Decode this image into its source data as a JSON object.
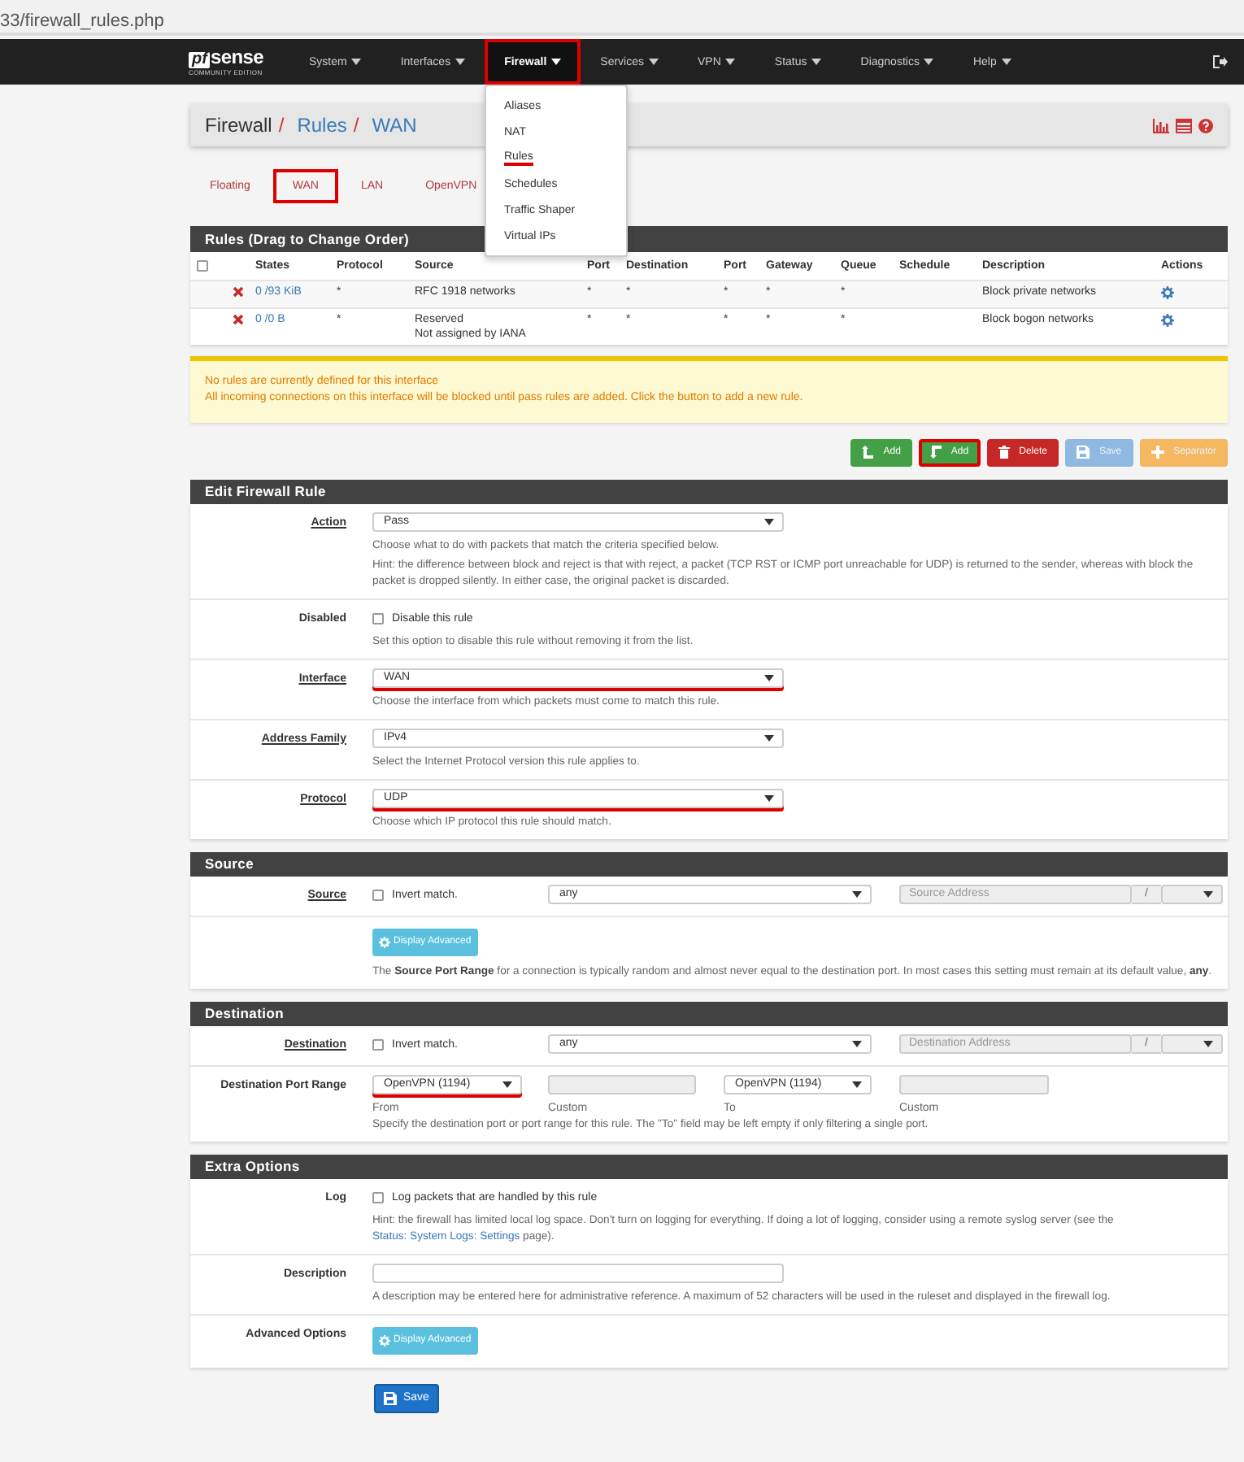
{
  "address_bar": {
    "url": "33/firewall_rules.php"
  },
  "navbar": {
    "logo_mark": "pf",
    "logo_text": "sense",
    "logo_subtitle": "COMMUNITY EDITION",
    "menu": [
      {
        "label": "System",
        "selected": false
      },
      {
        "label": "Interfaces",
        "selected": false
      },
      {
        "label": "Firewall",
        "selected": true
      },
      {
        "label": "Services",
        "selected": false
      },
      {
        "label": "VPN",
        "selected": false
      },
      {
        "label": "Status",
        "selected": false
      },
      {
        "label": "Diagnostics",
        "selected": false
      },
      {
        "label": "Help",
        "selected": false
      }
    ],
    "dropdown": [
      {
        "label": "Aliases",
        "selected": false
      },
      {
        "label": "NAT",
        "selected": false
      },
      {
        "label": "Rules",
        "selected": true
      },
      {
        "label": "Schedules",
        "selected": false
      },
      {
        "label": "Traffic Shaper",
        "selected": false
      },
      {
        "label": "Virtual IPs",
        "selected": false
      }
    ]
  },
  "breadcrumb": {
    "separator": "/",
    "items": [
      {
        "label": "Firewall",
        "link": false
      },
      {
        "label": "Rules",
        "link": true
      },
      {
        "label": "WAN",
        "link": true
      }
    ]
  },
  "tabs": [
    {
      "label": "Floating",
      "selected": false
    },
    {
      "label": "WAN",
      "selected": true
    },
    {
      "label": "LAN",
      "selected": false
    },
    {
      "label": "OpenVPN",
      "selected": false
    }
  ],
  "rules_table": {
    "title": "Rules (Drag to Change Order)",
    "select_all_checked": false,
    "columns": [
      "States",
      "Protocol",
      "Source",
      "Port",
      "Destination",
      "Port",
      "Gateway",
      "Queue",
      "Schedule",
      "Description",
      "Actions"
    ],
    "rows": [
      {
        "states": "0 /93 KiB",
        "protocol": "*",
        "source": [
          "RFC 1918 networks"
        ],
        "source_port": "*",
        "destination": "*",
        "destination_port": "*",
        "gateway": "*",
        "queue": "*",
        "description": "Block private networks"
      },
      {
        "states": "0 /0 B",
        "protocol": "*",
        "source": [
          "Reserved",
          "Not assigned by IANA"
        ],
        "source_port": "*",
        "destination": "*",
        "destination_port": "*",
        "gateway": "*",
        "queue": "*",
        "description": "Block bogon networks"
      }
    ]
  },
  "alert": {
    "lines": [
      "No rules are currently defined for this interface",
      "All incoming connections on this interface will be blocked until pass rules are added. Click the button to add a new rule."
    ]
  },
  "buttons": [
    {
      "kind": "add_top",
      "label": "Add",
      "color": "#43a047",
      "highlighted": false,
      "disabled": false
    },
    {
      "kind": "add_bottom",
      "label": "Add",
      "color": "#43a047",
      "highlighted": true,
      "disabled": false
    },
    {
      "kind": "delete",
      "label": "Delete",
      "color": "#c62828",
      "highlighted": false,
      "disabled": false
    },
    {
      "kind": "save",
      "label": "Save",
      "color": "#8fb9e0",
      "highlighted": false,
      "disabled": true
    },
    {
      "kind": "separator",
      "label": "Separator",
      "color": "#f5b760",
      "highlighted": false,
      "disabled": true
    }
  ],
  "sections": [
    {
      "title": "Edit Firewall Rule",
      "rows": [
        {
          "kind": "select",
          "label": "Action",
          "required": true,
          "value": "Pass",
          "marked": false,
          "help": [
            "Choose what to do with packets that match the criteria specified below.",
            "Hint: the difference between block and reject is that with reject, a packet (TCP RST or ICMP port unreachable for UDP) is returned to the sender, whereas with block the packet is dropped silently. In either case, the original packet is discarded."
          ]
        },
        {
          "kind": "checkbox",
          "label": "Disabled",
          "required": false,
          "checked": false,
          "text": "Disable this rule",
          "help": [
            "Set this option to disable this rule without removing it from the list."
          ]
        },
        {
          "kind": "select",
          "label": "Interface",
          "required": true,
          "value": "WAN",
          "marked": true,
          "help": [
            "Choose the interface from which packets must come to match this rule."
          ]
        },
        {
          "kind": "select",
          "label": "Address Family",
          "required": true,
          "value": "IPv4",
          "marked": false,
          "help": [
            "Select the Internet Protocol version this rule applies to."
          ]
        },
        {
          "kind": "select",
          "label": "Protocol",
          "required": true,
          "value": "UDP",
          "marked": true,
          "help": [
            "Choose which IP protocol this rule should match."
          ]
        }
      ]
    },
    {
      "title": "Source",
      "rows": [
        {
          "kind": "address",
          "label": "Source",
          "required": true,
          "invert_text": "Invert match.",
          "checked": false,
          "value": "any",
          "address_placeholder": "Source Address",
          "slash": "/"
        },
        {
          "kind": "advanced",
          "button": "Display Advanced",
          "help": [
            "The **Source Port Range** for a connection is typically random and almost never equal to the destination port. In most cases this setting must remain at its default value, **any**."
          ]
        }
      ]
    },
    {
      "title": "Destination",
      "rows": [
        {
          "kind": "address",
          "label": "Destination",
          "required": true,
          "invert_text": "Invert match.",
          "checked": false,
          "value": "any",
          "address_placeholder": "Destination Address",
          "slash": "/"
        },
        {
          "kind": "port_range",
          "label": "Destination Port Range",
          "required": false,
          "from": {
            "value": "OpenVPN (1194)",
            "marked": true
          },
          "from_label": "From",
          "from_custom_label": "Custom",
          "to": {
            "value": "OpenVPN (1194)",
            "marked": false
          },
          "to_label": "To",
          "to_custom_label": "Custom",
          "help": [
            "Specify the destination port or port range for this rule. The \"To\" field may be left empty if only filtering a single port."
          ]
        }
      ]
    },
    {
      "title": "Extra Options",
      "rows": [
        {
          "kind": "checkbox",
          "label": "Log",
          "required": false,
          "checked": false,
          "text": "Log packets that are handled by this rule",
          "help_before": "Hint: the firewall has limited local log space. Don't turn on logging for everything. If doing a lot of logging, consider using a remote syslog server (see the ",
          "help_link": "Status: System Logs: Settings",
          "help_after": " page)."
        },
        {
          "kind": "text",
          "label": "Description",
          "required": false,
          "help": [
            "A description may be entered here for administrative reference. A maximum of 52 characters will be used in the ruleset and displayed in the firewall log."
          ]
        },
        {
          "kind": "advanced",
          "label": "Advanced Options",
          "required": false,
          "button": "Display Advanced"
        }
      ]
    }
  ],
  "save_button": {
    "label": "Save"
  }
}
